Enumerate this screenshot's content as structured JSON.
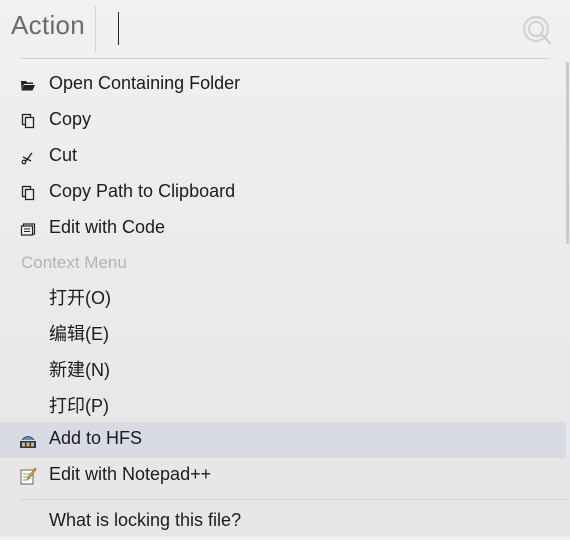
{
  "header": {
    "title": "Action",
    "search_icon": "search-refresh-icon"
  },
  "items": [
    {
      "label": "Open Containing Folder",
      "icon": "folder-open-icon"
    },
    {
      "label": "Copy",
      "icon": "copy-icon"
    },
    {
      "label": "Cut",
      "icon": "scissors-icon"
    },
    {
      "label": "Copy Path to Clipboard",
      "icon": "copy-icon"
    },
    {
      "label": "Edit with Code",
      "icon": "code-editor-icon"
    }
  ],
  "context_menu": {
    "title": "Context Menu",
    "items": [
      {
        "label": "打开(O)"
      },
      {
        "label": "编辑(E)"
      },
      {
        "label": "新建(N)"
      },
      {
        "label": "打印(P)"
      },
      {
        "label": "Add to HFS",
        "icon": "hfs-icon",
        "highlighted": true
      },
      {
        "label": "Edit with Notepad++",
        "icon": "notepad-plus-plus-icon"
      },
      {
        "label": "What is locking this file?"
      }
    ]
  },
  "colors": {
    "highlight": "#d8dbe1",
    "section_text": "#b4b4b4",
    "title_text": "#6a6a6a"
  }
}
